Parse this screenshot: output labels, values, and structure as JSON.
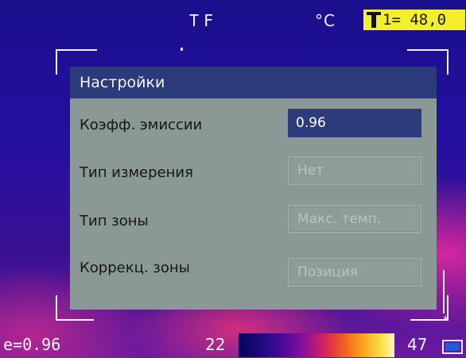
{
  "topbar": {
    "mode": "TF",
    "unit": "°C",
    "spot_temp": "1= 48,0"
  },
  "settings": {
    "title": "Настройки",
    "rows": [
      {
        "label": "Коэфф. эмиссии",
        "value": "0.96",
        "state": "active"
      },
      {
        "label": "Тип измерения",
        "value": "Нет",
        "state": "inactive"
      },
      {
        "label": "Тип зоны",
        "value": "Макс. темп.",
        "state": "inactive"
      },
      {
        "label": "Коррекц. зоны",
        "value": "Позиция",
        "state": "inactive"
      }
    ]
  },
  "bottombar": {
    "emissivity": "e=0.96",
    "scale_min": "22",
    "scale_max": "47"
  },
  "colors": {
    "highlight": "#2d3b7c",
    "panel": "#8a9896",
    "temp_box": "#f3ef2a"
  },
  "icons": [
    "thermometer-icon",
    "battery-icon"
  ]
}
